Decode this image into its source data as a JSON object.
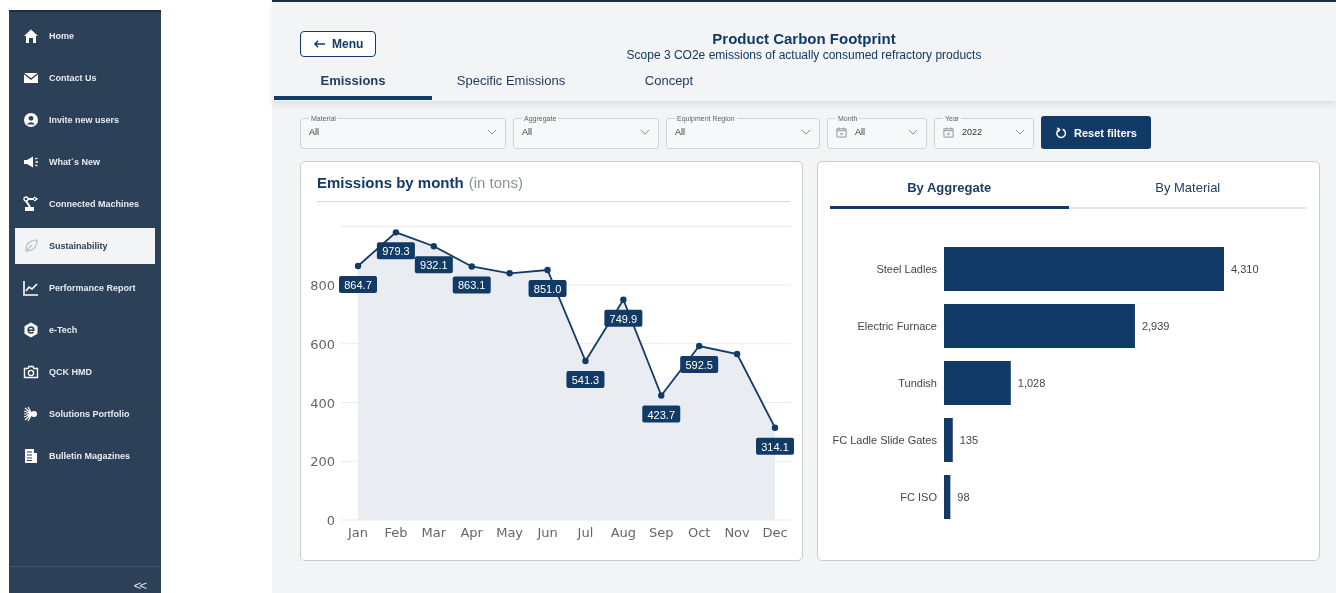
{
  "sidebar": {
    "items": [
      {
        "label": "Home",
        "selected": false
      },
      {
        "label": "Contact Us",
        "selected": false
      },
      {
        "label": "Invite new users",
        "selected": false
      },
      {
        "label": "What´s New",
        "selected": false
      },
      {
        "label": "Connected Machines",
        "selected": false
      },
      {
        "label": "Sustainability",
        "selected": true
      },
      {
        "label": "Performance Report",
        "selected": false
      },
      {
        "label": "e-Tech",
        "selected": false
      },
      {
        "label": "QCK HMD",
        "selected": false
      },
      {
        "label": "Solutions Portfolio",
        "selected": false
      },
      {
        "label": "Bulletin Magazines",
        "selected": false
      }
    ],
    "collapse_button": "<<"
  },
  "header": {
    "menu_button": "Menu",
    "title": "Product Carbon Footprint",
    "subtitle": "Scope 3 CO2e emissions of actually consumed refractory products"
  },
  "tabs": [
    {
      "label": "Emissions",
      "selected": true
    },
    {
      "label": "Specific Emissions",
      "selected": false
    },
    {
      "label": "Concept",
      "selected": false
    }
  ],
  "filters": [
    {
      "label": "Material",
      "value": "All",
      "kind": "select"
    },
    {
      "label": "Aggregate",
      "value": "All",
      "kind": "select"
    },
    {
      "label": "Equipment Region",
      "value": "All",
      "kind": "select"
    },
    {
      "label": "Month",
      "value": "All",
      "kind": "date"
    },
    {
      "label": "Year",
      "value": "2022",
      "kind": "date"
    }
  ],
  "reset_button": "Reset filters",
  "emissions_card": {
    "title": "Emissions by month",
    "unit": "(in tons)",
    "chart_data": {
      "type": "area",
      "categories": [
        "Jan",
        "Feb",
        "Mar",
        "Apr",
        "May",
        "Jun",
        "Jul",
        "Aug",
        "Sep",
        "Oct",
        "Nov",
        "Dec"
      ],
      "values": [
        864.7,
        979.3,
        932.1,
        863.1,
        840,
        851.0,
        541.3,
        749.9,
        423.7,
        592.5,
        565,
        314.1
      ],
      "value_labels": [
        "864.7",
        "979.3",
        "932.1",
        "863.1",
        null,
        "851.0",
        "541.3",
        "749.9",
        "423.7",
        "592.5",
        null,
        "314.1"
      ],
      "ylim": [
        0,
        1000
      ],
      "yticks": [
        0,
        200,
        400,
        600,
        800
      ],
      "grid": true
    }
  },
  "aggregate_card": {
    "tabs": [
      {
        "label": "By Aggregate",
        "selected": true
      },
      {
        "label": "By Material",
        "selected": false
      }
    ],
    "chart_data": {
      "type": "bar",
      "orientation": "horizontal",
      "categories": [
        "Steel Ladles",
        "Electric Furnace",
        "Tundish",
        "FC Ladle Slide Gates",
        "FC ISO"
      ],
      "values": [
        4310,
        2939,
        1028,
        135,
        98
      ],
      "value_labels": [
        "4,310",
        "2,939",
        "1,028",
        "135",
        "98"
      ]
    }
  }
}
